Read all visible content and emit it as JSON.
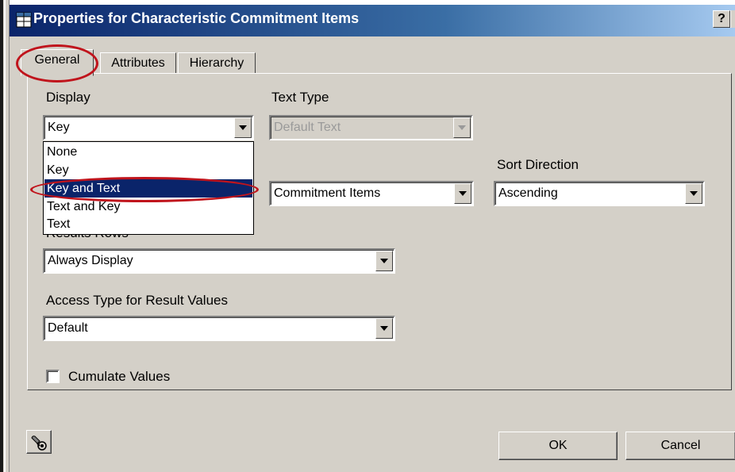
{
  "window": {
    "title": "Properties for Characteristic Commitment Items",
    "help_label": "?"
  },
  "tabs": [
    {
      "label": "General",
      "active": true
    },
    {
      "label": "Attributes",
      "active": false
    },
    {
      "label": "Hierarchy",
      "active": false
    }
  ],
  "display": {
    "label": "Display",
    "value": "Key",
    "options": [
      "None",
      "Key",
      "Key and Text",
      "Text and Key",
      "Text"
    ],
    "highlighted": "Key and Text"
  },
  "text_type": {
    "label": "Text Type",
    "value": "Default Text",
    "disabled": true
  },
  "sort_by": {
    "value": "Commitment Items"
  },
  "sort_direction": {
    "label": "Sort Direction",
    "value": "Ascending"
  },
  "results_rows": {
    "label": "Results Rows",
    "value": "Always Display"
  },
  "access_type": {
    "label": "Access Type for Result Values",
    "value": "Default"
  },
  "cumulate": {
    "label": "Cumulate Values",
    "checked": false
  },
  "buttons": {
    "ok": "OK",
    "cancel": "Cancel"
  },
  "icons": {
    "title_icon": "grid-table-icon",
    "tool_icon": "wrench-gear-icon"
  },
  "colors": {
    "titlebar_start": "#0a246a",
    "selection": "#0a246a",
    "dialog_face": "#d4d0c8",
    "annotation": "#c0141c"
  }
}
